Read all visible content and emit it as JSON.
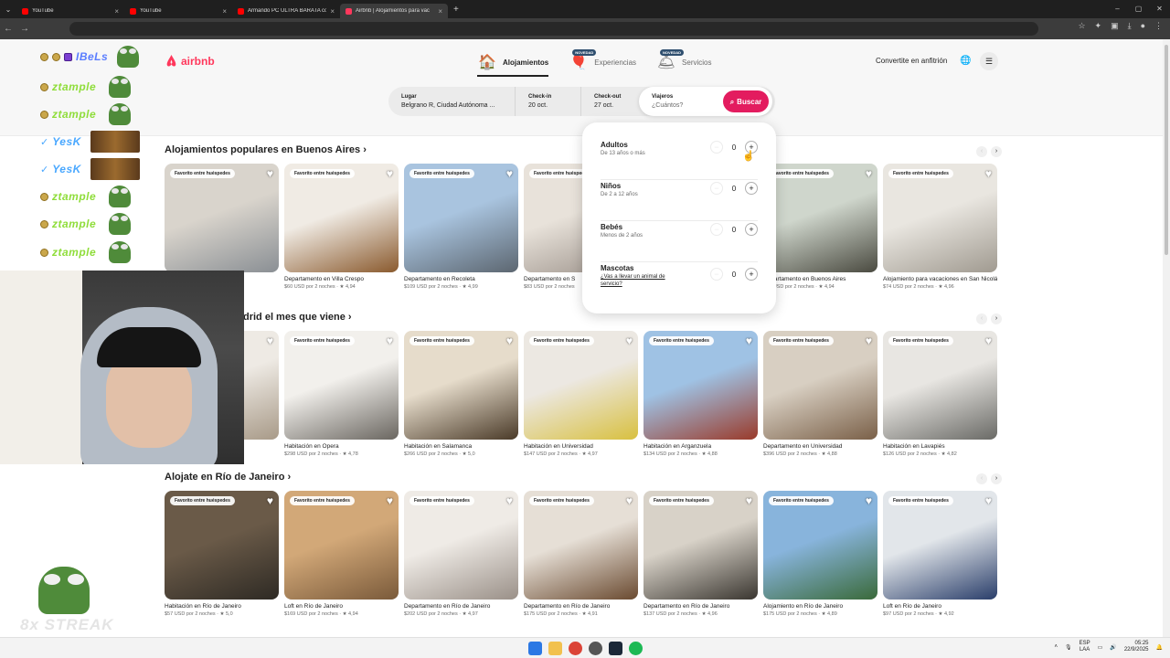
{
  "browser": {
    "tabs": [
      {
        "title": "YouTube",
        "color": "#ff0000",
        "active": false
      },
      {
        "title": "YouTube",
        "color": "#ff0000",
        "active": false
      },
      {
        "title": "Armando PC ULTRA BARATA co",
        "color": "#ff0000",
        "active": false
      },
      {
        "title": "Airbnb | Alojamientos para vac",
        "color": "#ff385c",
        "active": true
      }
    ],
    "new_tab": "+",
    "window_controls": [
      "–",
      "▢",
      "✕"
    ]
  },
  "header": {
    "logo_text": "airbnb",
    "nav": [
      {
        "label": "Alojamientos",
        "icon": "house-icon",
        "badge": ""
      },
      {
        "label": "Experiencias",
        "icon": "balloon-icon",
        "badge": "NOVEDAD"
      },
      {
        "label": "Servicios",
        "icon": "bell-icon",
        "badge": "NOVEDAD"
      }
    ],
    "host_link": "Convertite en anfitrión"
  },
  "search": {
    "place_label": "Lugar",
    "place_value": "Belgrano R, Ciudad Autónoma ...",
    "checkin_label": "Check-in",
    "checkin_value": "20 oct.",
    "checkout_label": "Check-out",
    "checkout_value": "27 oct.",
    "guests_label": "Viajeros",
    "guests_placeholder": "¿Cuántos?",
    "button_label": "Buscar"
  },
  "guests_popover": [
    {
      "label": "Adultos",
      "sub": "De 13 años o más",
      "value": "0",
      "link": false
    },
    {
      "label": "Niños",
      "sub": "De 2 a 12 años",
      "value": "0",
      "link": false
    },
    {
      "label": "Bebés",
      "sub": "Menos de 2 años",
      "value": "0",
      "link": false
    },
    {
      "label": "Mascotas",
      "sub": "¿Vas a llevar un animal de servicio?",
      "value": "0",
      "link": true
    }
  ],
  "fav_badge": "Favorito entre huéspedes",
  "sections": [
    {
      "title": "Alojamientos populares en Buenos Aires ›",
      "cards": [
        {
          "title": "",
          "meta": "",
          "img": [
            "#d9d4cc",
            "#8a8f94"
          ]
        },
        {
          "title": "Departamento en Villa Crespo",
          "meta": "$60 USD por 2 noches · ★ 4,94",
          "img": [
            "#f0ebe4",
            "#8a5a2e"
          ]
        },
        {
          "title": "Departamento en Recoleta",
          "meta": "$109 USD por 2 noches · ★ 4,99",
          "img": [
            "#a9c4df",
            "#5c6670"
          ]
        },
        {
          "title": "Departamento en S",
          "meta": "$83 USD por 2 noches",
          "img": [
            "#e8e2da",
            "#9a9088"
          ]
        },
        {
          "title": "",
          "meta": "",
          "img": [
            "#eee",
            "#ddd"
          ]
        },
        {
          "title": "Departamento en Buenos Aires",
          "meta": "$71 USD por 2 noches · ★ 4,94",
          "img": [
            "#cfd6cc",
            "#4a4a40"
          ]
        },
        {
          "title": "Alojamiento para vacaciones en San Nicolás",
          "meta": "$74 USD por 2 noches · ★ 4,96",
          "img": [
            "#e9e6e0",
            "#a09a90"
          ]
        }
      ]
    },
    {
      "title": "drid el mes que viene ›",
      "cards": [
        {
          "title": "",
          "meta": "",
          "img": [
            "#eeeae4",
            "#a89a88"
          ]
        },
        {
          "title": "Habitación en Opera",
          "meta": "$298 USD por 2 noches · ★ 4,78",
          "img": [
            "#f2f0ec",
            "#6a6660"
          ]
        },
        {
          "title": "Habitación en Salamanca",
          "meta": "$266 USD por 2 noches · ★ 5,0",
          "img": [
            "#e6dccb",
            "#4a3a28"
          ]
        },
        {
          "title": "Habitación en Universidad",
          "meta": "$147 USD por 2 noches · ★ 4,97",
          "img": [
            "#ece8e2",
            "#d8c040"
          ]
        },
        {
          "title": "Habitación en Arganzuela",
          "meta": "$134 USD por 2 noches · ★ 4,88",
          "img": [
            "#9fc2e4",
            "#9a3a2a"
          ]
        },
        {
          "title": "Departamento en Universidad",
          "meta": "$396 USD por 2 noches · ★ 4,88",
          "img": [
            "#d8cfc2",
            "#7a6048"
          ]
        },
        {
          "title": "Habitación en Lavapiés",
          "meta": "$126 USD por 2 noches · ★ 4,82",
          "img": [
            "#e8e6e2",
            "#6a6a66"
          ]
        }
      ]
    },
    {
      "title": "Alojate en Río de Janeiro ›",
      "cards": [
        {
          "title": "Habitación en Río de Janeiro",
          "meta": "$57 USD por 2 noches · ★ 5,0",
          "img": [
            "#6a5a48",
            "#2e2a24"
          ]
        },
        {
          "title": "Loft en Río de Janeiro",
          "meta": "$169 USD por 2 noches · ★ 4,94",
          "img": [
            "#d2a878",
            "#7a5a3a"
          ]
        },
        {
          "title": "Departamento en Río de Janeiro",
          "meta": "$202 USD por 2 noches · ★ 4,97",
          "img": [
            "#efebe6",
            "#9a9088"
          ]
        },
        {
          "title": "Departamento en Río de Janeiro",
          "meta": "$175 USD por 2 noches · ★ 4,91",
          "img": [
            "#e6dfd6",
            "#6a4a30"
          ]
        },
        {
          "title": "Departamento en Río de Janeiro",
          "meta": "$137 USD por 2 noches · ★ 4,96",
          "img": [
            "#d8d2c8",
            "#3a3630"
          ]
        },
        {
          "title": "Alojamiento en Río de Janeiro",
          "meta": "$175 USD por 2 noches · ★ 4,89",
          "img": [
            "#88b4dc",
            "#3a6a3a"
          ]
        },
        {
          "title": "Loft en Río de Janeiro",
          "meta": "$97 USD por 2 noches · ★ 4,92",
          "img": [
            "#e2e6ea",
            "#2a3e6a"
          ]
        }
      ]
    }
  ],
  "stream_overlay": {
    "users": [
      {
        "name": "IBeLs",
        "color": "#5a7dff",
        "extra": "frog"
      },
      {
        "name": "ztample",
        "color": "#8fdd3a",
        "extra": "frog"
      },
      {
        "name": "ztample",
        "color": "#8fdd3a",
        "extra": "frog"
      },
      {
        "name": "YesK",
        "color": "#4aa8ff",
        "extra": "cat"
      },
      {
        "name": "YesK",
        "color": "#4aa8ff",
        "extra": "cat"
      },
      {
        "name": "ztample",
        "color": "#8fdd3a",
        "extra": "frog"
      },
      {
        "name": "ztample",
        "color": "#8fdd3a",
        "extra": "frog"
      },
      {
        "name": "ztample",
        "color": "#8fdd3a",
        "extra": "frog"
      }
    ],
    "streak_text": "8x STREAK"
  },
  "taskbar": {
    "lang_top": "ESP",
    "lang_bottom": "LAA",
    "time": "05:25",
    "date": "22/9/2025"
  }
}
